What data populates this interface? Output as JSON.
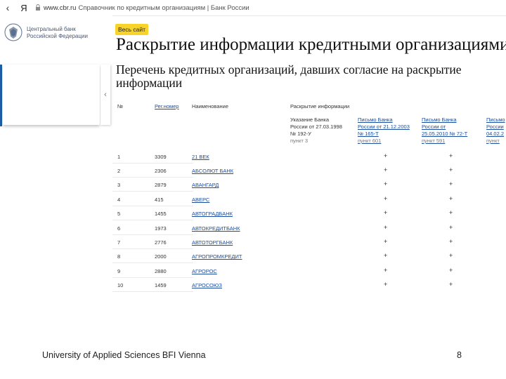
{
  "browser": {
    "yandex": "Я",
    "domain": "www.cbr.ru",
    "page_title": "Справочник по кредитным организациям | Банк России"
  },
  "site": {
    "bank_name_line1": "Центральный банк",
    "bank_name_line2": "Российской Федерации",
    "all_site": "Весь сайт",
    "collapse": "‹",
    "heading": "Раскрытие информации кредитными организациями",
    "subheading": "Перечень кредитных организаций, давших согласие на раскрытие информации"
  },
  "table": {
    "headers": {
      "num": "№",
      "reg": "Рег.номер",
      "name": "Наименование",
      "disclosure": "Раскрытие информации"
    },
    "subheaders": [
      {
        "l1": "Указание Банка",
        "l2": "России от 27.03.1998",
        "l3": "№ 192-У",
        "l4": "пункт 3"
      },
      {
        "l1": "Письмо Банка",
        "l2": "России от 21.12.2003",
        "l3": "№ 165-Т",
        "l4": "пункт 601"
      },
      {
        "l1": "Письмо Банка",
        "l2": "России от",
        "l3": "25.05.2010 № 72-Т",
        "l4": "пункт 591"
      },
      {
        "l1": "Письмо",
        "l2": "России",
        "l3": "04.02.2",
        "l4": "пункт"
      }
    ],
    "rows": [
      {
        "n": "1",
        "reg": "3309",
        "name": "21 ВЕК",
        "m1": "+",
        "m2": "+"
      },
      {
        "n": "2",
        "reg": "2306",
        "name": "АБСОЛЮТ БАНК",
        "m1": "+",
        "m2": "+"
      },
      {
        "n": "3",
        "reg": "2879",
        "name": "АВАНГАРД",
        "m1": "+",
        "m2": "+"
      },
      {
        "n": "4",
        "reg": "415",
        "name": "АВЕРС",
        "m1": "+",
        "m2": "+"
      },
      {
        "n": "5",
        "reg": "1455",
        "name": "АВТОГРАДБАНК",
        "m1": "+",
        "m2": "+"
      },
      {
        "n": "6",
        "reg": "1973",
        "name": "АВТОКРЕДИТБАНК",
        "m1": "+",
        "m2": "+"
      },
      {
        "n": "7",
        "reg": "2776",
        "name": "АВТОТОРГБАНК",
        "m1": "+",
        "m2": "+"
      },
      {
        "n": "8",
        "reg": "2000",
        "name": "АГРОПРОМКРЕДИТ",
        "m1": "+",
        "m2": "+"
      },
      {
        "n": "9",
        "reg": "2880",
        "name": "АГРОРОС",
        "m1": "+",
        "m2": "+"
      },
      {
        "n": "10",
        "reg": "1459",
        "name": "АГРОСОЮЗ",
        "m1": "+",
        "m2": "+"
      }
    ]
  },
  "footer": {
    "institution": "University of Applied Sciences BFI Vienna",
    "page": "8"
  }
}
